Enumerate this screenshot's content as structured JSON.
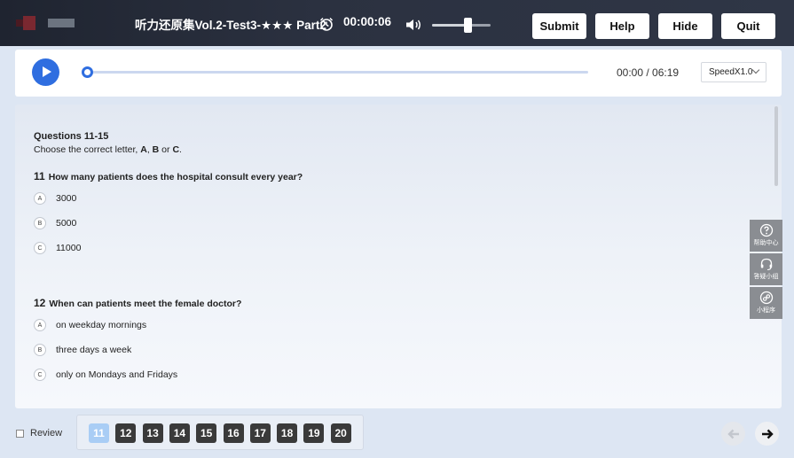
{
  "header": {
    "title": "听力还原集Vol.2-Test3-★★★ Part2",
    "timer": "00:00:06",
    "volume_level": 0.62,
    "buttons": {
      "submit": "Submit",
      "help": "Help",
      "hide": "Hide",
      "quit": "Quit"
    },
    "colors": {
      "bar": "#2b3140",
      "button_bg": "#ffffff"
    }
  },
  "player": {
    "time": "00:00 / 06:19",
    "speed": "SpeedX1.0",
    "progress": 0,
    "accent": "#2f6ee0"
  },
  "section": {
    "heading": "Questions 11-15",
    "instruction_pre": "Choose the correct letter, ",
    "letter_a": "A",
    "sep1": ", ",
    "letter_b": "B",
    "sep2": " or ",
    "letter_c": "C",
    "instruction_post": "."
  },
  "questions": [
    {
      "number": "11",
      "text": "How many patients does the hospital consult every year?",
      "options": [
        {
          "letter": "A",
          "text": "3000"
        },
        {
          "letter": "B",
          "text": "5000"
        },
        {
          "letter": "C",
          "text": "11000"
        }
      ]
    },
    {
      "number": "12",
      "text": "When can patients meet the female doctor?",
      "options": [
        {
          "letter": "A",
          "text": "on weekday mornings"
        },
        {
          "letter": "B",
          "text": "three days a week"
        },
        {
          "letter": "C",
          "text": "only on Mondays and Fridays"
        }
      ]
    }
  ],
  "side_tools": [
    {
      "label": "帮助中心",
      "icon": "question-circle-icon"
    },
    {
      "label": "答疑小组",
      "icon": "headset-icon"
    },
    {
      "label": "小程序",
      "icon": "mini-program-icon"
    }
  ],
  "footer": {
    "review_label": "Review",
    "question_numbers": [
      "11",
      "12",
      "13",
      "14",
      "15",
      "16",
      "17",
      "18",
      "19",
      "20"
    ],
    "active_question": "11"
  }
}
